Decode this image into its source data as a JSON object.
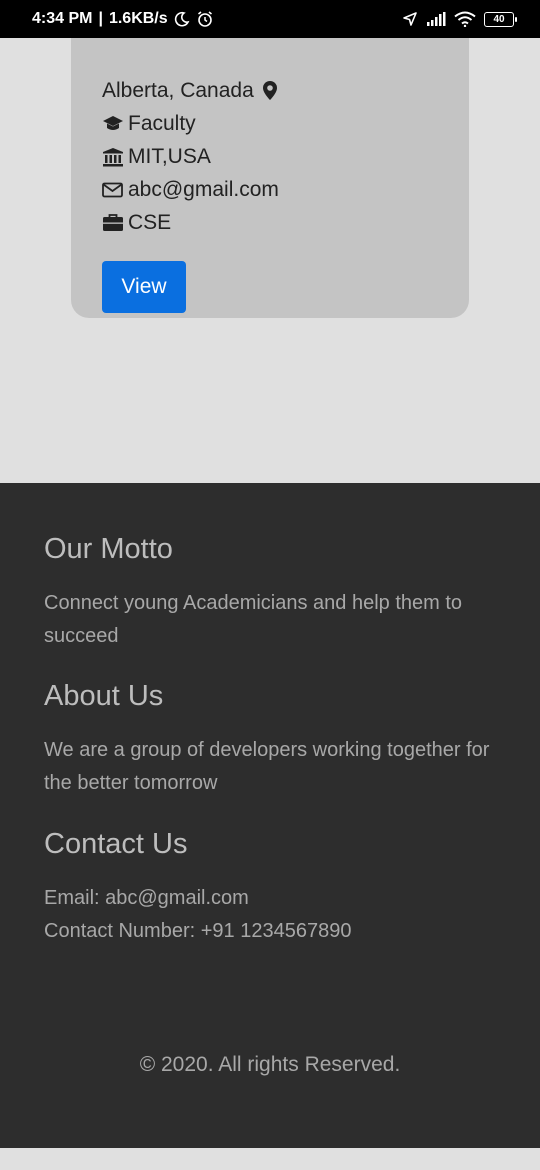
{
  "status_bar": {
    "time": "4:34 PM",
    "separator": "|",
    "speed": "1.6KB/s",
    "battery": "40",
    "icons": [
      "moon-icon",
      "alarm-icon",
      "location-arrow-icon",
      "signal-icon",
      "wifi-icon",
      "battery-icon"
    ]
  },
  "card": {
    "location": "Alberta, Canada",
    "role": "Faculty",
    "institution": "MIT,USA",
    "email": "abc@gmail.com",
    "department": "CSE",
    "view_label": "View",
    "button_color": "#0a6fe0"
  },
  "footer": {
    "motto_title": "Our Motto",
    "motto_text": "Connect young Academicians and help them to succeed",
    "about_title": "About Us",
    "about_text": "We are a group of developers working together for the better tomorrow",
    "contact_title": "Contact Us",
    "contact_email": "Email: abc@gmail.com",
    "contact_number": "Contact Number: +91 1234567890",
    "copyright": "© 2020. All rights Reserved."
  }
}
